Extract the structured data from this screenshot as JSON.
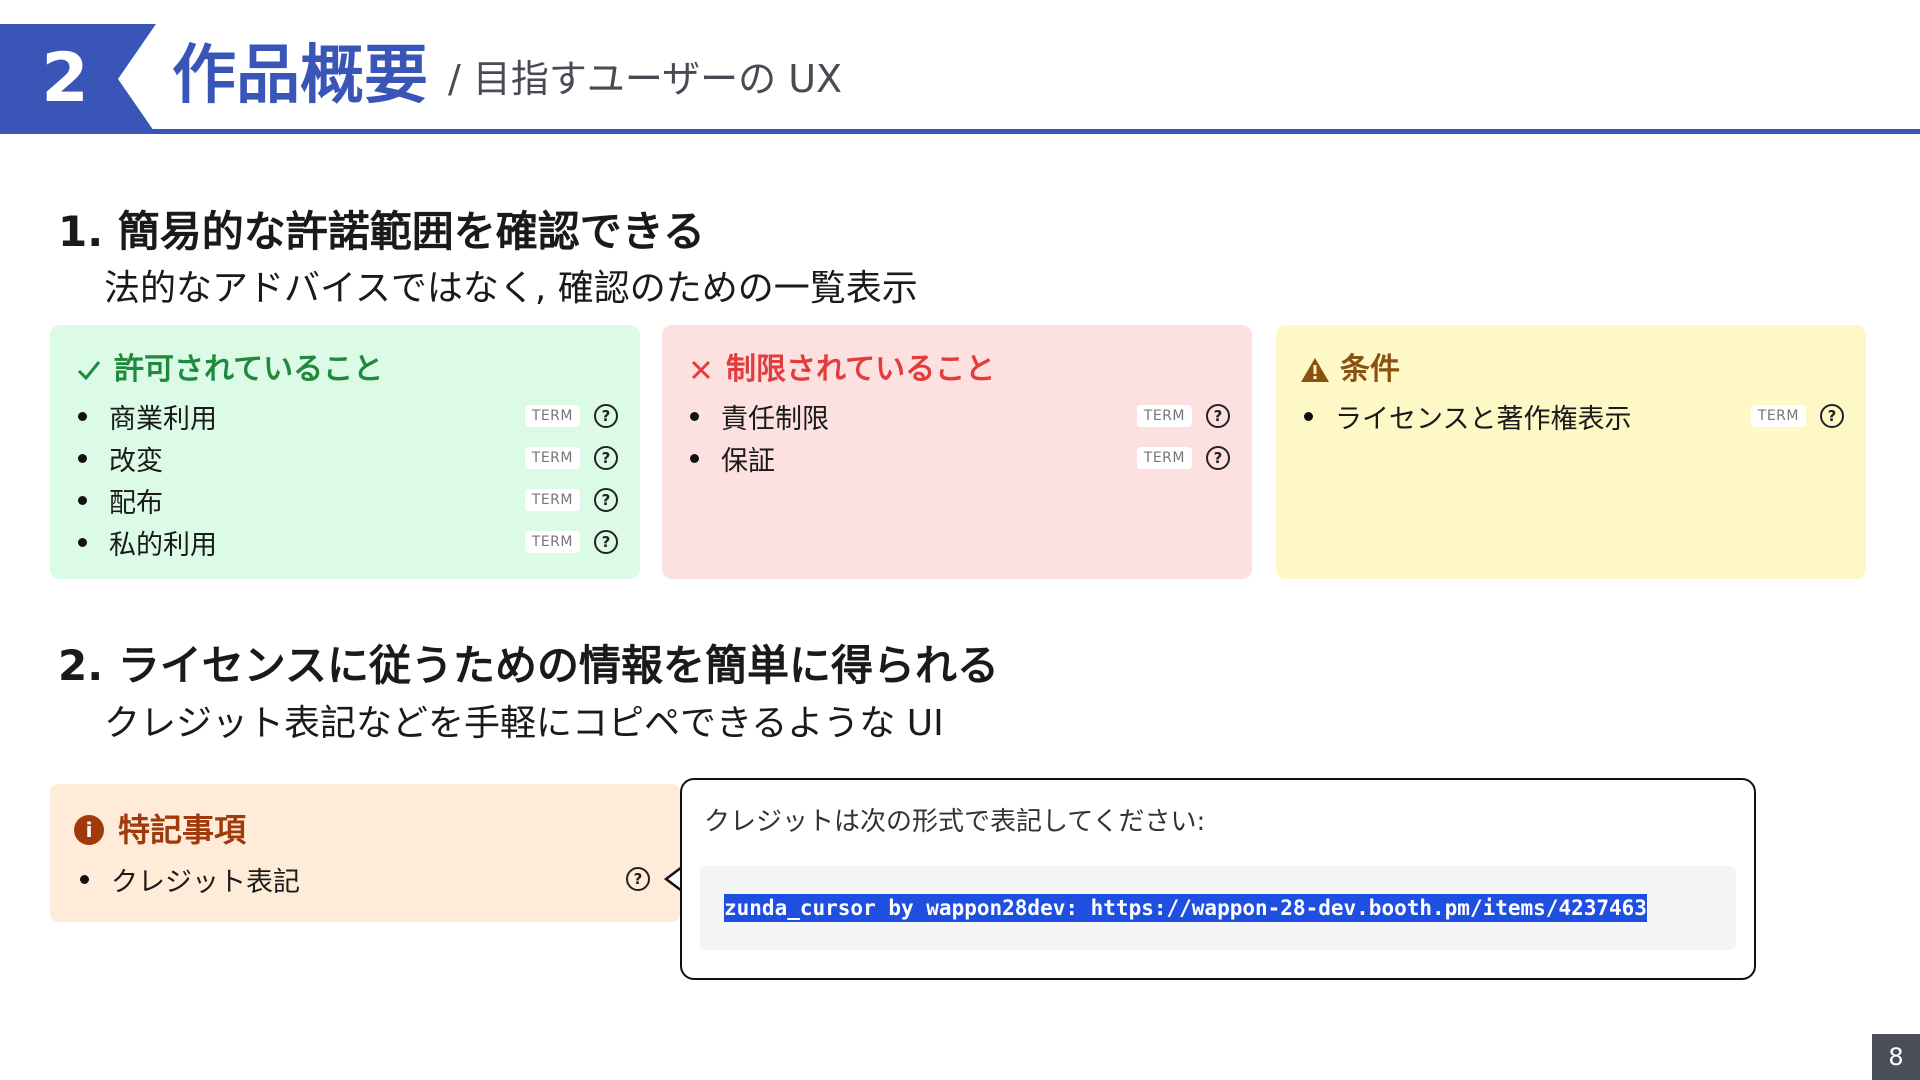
{
  "header": {
    "section_number": "2",
    "title": "作品概要",
    "subtitle": "/ 目指すユーザーの UX",
    "accent_color": "#3a55b8"
  },
  "section1": {
    "heading": "1. 簡易的な許諾範囲を確認できる",
    "description": "法的なアドバイスではなく, 確認のための一覧表示",
    "cards": {
      "permitted": {
        "icon": "check-icon",
        "title": "許可されていること",
        "items": [
          {
            "label": "商業利用",
            "badge": "TERM"
          },
          {
            "label": "改変",
            "badge": "TERM"
          },
          {
            "label": "配布",
            "badge": "TERM"
          },
          {
            "label": "私的利用",
            "badge": "TERM"
          }
        ]
      },
      "restricted": {
        "icon": "cross-icon",
        "title": "制限されていること",
        "items": [
          {
            "label": "責任制限",
            "badge": "TERM"
          },
          {
            "label": "保証",
            "badge": "TERM"
          }
        ]
      },
      "conditions": {
        "icon": "warning-icon",
        "title": "条件",
        "items": [
          {
            "label": "ライセンスと著作権表示",
            "badge": "TERM"
          }
        ]
      }
    }
  },
  "section2": {
    "heading": "2. ライセンスに従うための情報を簡単に得られる",
    "description": "クレジット表記などを手軽にコピペできるような UI",
    "note": {
      "icon": "info-icon",
      "title": "特記事項",
      "item": "クレジット表記"
    },
    "popup": {
      "text": "クレジットは次の形式で表記してください:",
      "code": "zunda_cursor by wappon28dev: https://wappon-28-dev.booth.pm/items/4237463"
    }
  },
  "page_number": "8"
}
